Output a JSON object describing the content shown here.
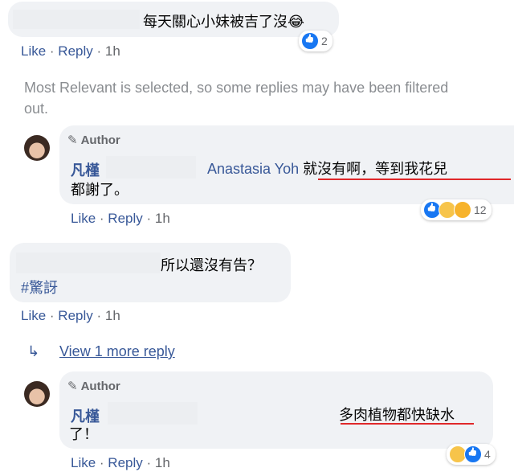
{
  "comment1": {
    "text": "每天關心小妹被吉了沒",
    "emoji": "😂",
    "reaction_count": "2",
    "actions": {
      "like": "Like",
      "reply": "Reply",
      "time": "1h"
    }
  },
  "filter_notice": "Most Relevant is selected, so some replies may have been filtered",
  "filter_notice_line2": "out.",
  "reply1": {
    "badge": "Author",
    "name": "凡槿",
    "mention": "Anastasia Yoh",
    "text_line1": "就沒有啊，等到我花兒",
    "text_line2": "都謝了。",
    "reaction_count": "12",
    "actions": {
      "like": "Like",
      "reply": "Reply",
      "time": "1h"
    }
  },
  "comment2": {
    "text_line1": "所以還沒有告？",
    "text_line2": "#驚訝",
    "actions": {
      "like": "Like",
      "reply": "Reply",
      "time": "1h"
    }
  },
  "view_more": "View 1 more reply",
  "reply2": {
    "badge": "Author",
    "name": "凡槿",
    "text_line1": "多肉植物都快缺水",
    "text_line2": "了！",
    "reaction_count": "4",
    "actions": {
      "like": "Like",
      "reply": "Reply",
      "time": "1h"
    }
  },
  "colors": {
    "link": "#385898",
    "muted": "#65676b",
    "bubble": "#f0f2f5",
    "underline": "#e0282a"
  }
}
